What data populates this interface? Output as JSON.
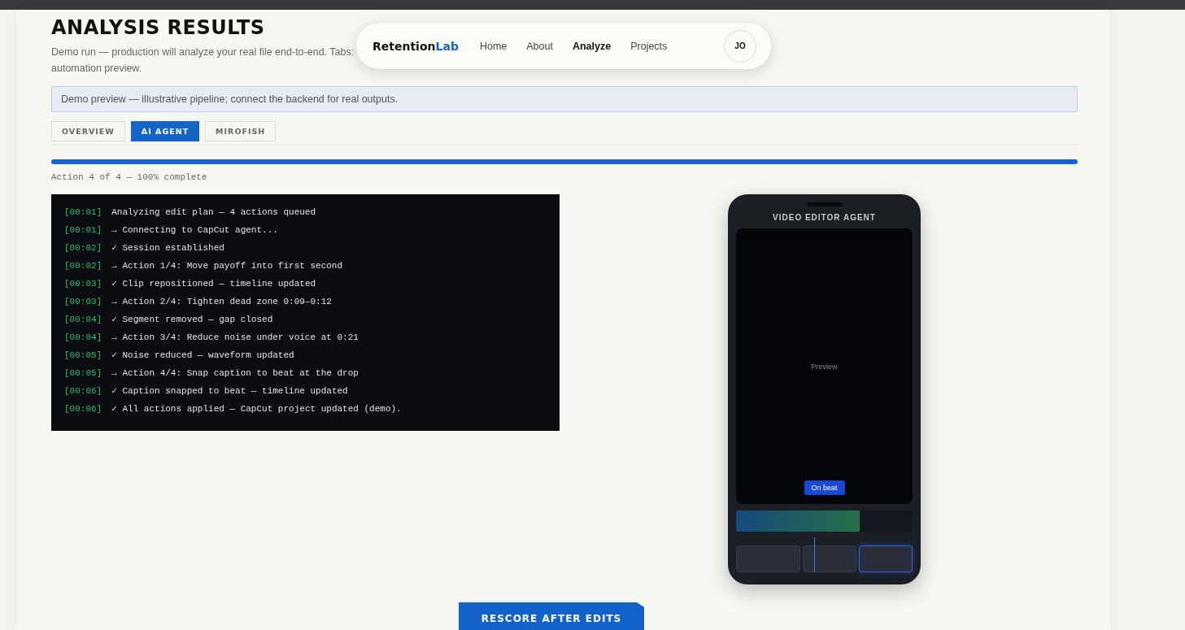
{
  "nav": {
    "logo_main": "Retention",
    "logo_accent": "Lab",
    "links": [
      {
        "label": "Home",
        "selected": false
      },
      {
        "label": "About",
        "selected": false
      },
      {
        "label": "Analyze",
        "selected": true
      },
      {
        "label": "Projects",
        "selected": false
      }
    ],
    "avatar": "JO"
  },
  "title": "ANALYSIS RESULTS",
  "description_lines": [
    "Demo run — production will analyze your real file end-to-end. Tabs:",
    "automation preview."
  ],
  "notice": "Demo preview — illustrative pipeline; connect the backend for real outputs.",
  "tabs": [
    {
      "label": "OVERVIEW",
      "selected": false
    },
    {
      "label": "AI AGENT",
      "selected": true
    },
    {
      "label": "MIROFISH",
      "selected": false
    }
  ],
  "progress": {
    "level": 1,
    "caption": "Action 4 of 4 — 100% complete"
  },
  "log": [
    {
      "time": "[00:01]",
      "text": "Analyzing edit plan — 4 actions queued"
    },
    {
      "time": "[00:01]",
      "text": "→ Connecting to CapCut agent..."
    },
    {
      "time": "[00:02]",
      "text": "✓ Session established"
    },
    {
      "time": "[00:02]",
      "text": "→ Action 1/4: Move payoff into first second"
    },
    {
      "time": "[00:03]",
      "text": "✓ Clip repositioned — timeline updated"
    },
    {
      "time": "[00:03]",
      "text": "→ Action 2/4: Tighten dead zone 0:09–0:12"
    },
    {
      "time": "[00:04]",
      "text": "✓ Segment removed — gap closed"
    },
    {
      "time": "[00:04]",
      "text": "→ Action 3/4: Reduce noise under voice at 0:21"
    },
    {
      "time": "[00:05]",
      "text": "✓ Noise reduced — waveform updated"
    },
    {
      "time": "[00:05]",
      "text": "→ Action 4/4: Snap caption to beat at the drop"
    },
    {
      "time": "[00:06]",
      "text": "✓ Caption snapped to beat — timeline updated"
    },
    {
      "time": "[00:06]",
      "text": "✓ All actions applied — CapCut project updated (demo)."
    }
  ],
  "phone": {
    "title": "VIDEO EDITOR AGENT",
    "preview_label": "Preview",
    "caption_chip": "On beat",
    "track": {
      "level": 0.7
    },
    "clips": [
      {
        "selected": false
      },
      {
        "selected": false
      },
      {
        "selected": true
      }
    ]
  },
  "rescore_button": "RESCORE AFTER EDITS"
}
